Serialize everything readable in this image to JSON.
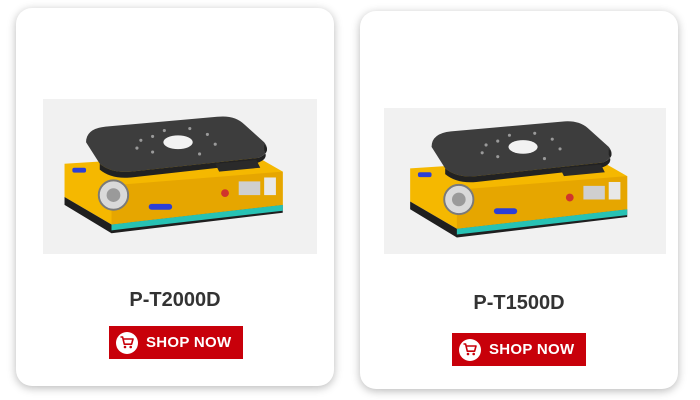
{
  "products": [
    {
      "name": "P-T2000D",
      "button_label": "SHOP NOW",
      "image_icon": "agv-robot-image"
    },
    {
      "name": "P-T1500D",
      "button_label": "SHOP NOW",
      "image_icon": "agv-robot-image"
    }
  ],
  "colors": {
    "button_bg": "#c8000a",
    "robot_body": "#f5b800",
    "robot_top": "#3d3d3d",
    "title_text": "#333333"
  },
  "icons": {
    "cart": "shopping-cart-icon"
  }
}
